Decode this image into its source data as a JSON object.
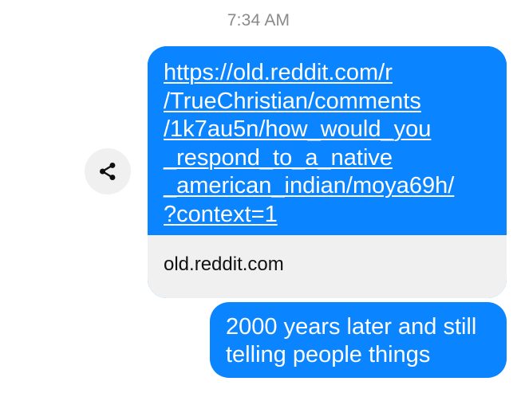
{
  "conversation": {
    "timestamp": "7:34 AM",
    "messages": [
      {
        "type": "link",
        "link_lines": [
          "https://old.reddit.com/r",
          "/TrueChristian/comments",
          "/1k7au5n/how_would_you",
          "_respond_to_a_native",
          "_american_indian/moya69h/",
          "?context=1"
        ],
        "preview_domain": "old.reddit.com"
      },
      {
        "type": "text",
        "text_lines": [
          "2000 years later and still",
          "telling people things"
        ]
      }
    ],
    "share_icon": "share-icon",
    "colors": {
      "bubble": "#0a84ff",
      "preview_bg": "#f0f0f0",
      "timestamp": "#8a8a8a"
    }
  }
}
